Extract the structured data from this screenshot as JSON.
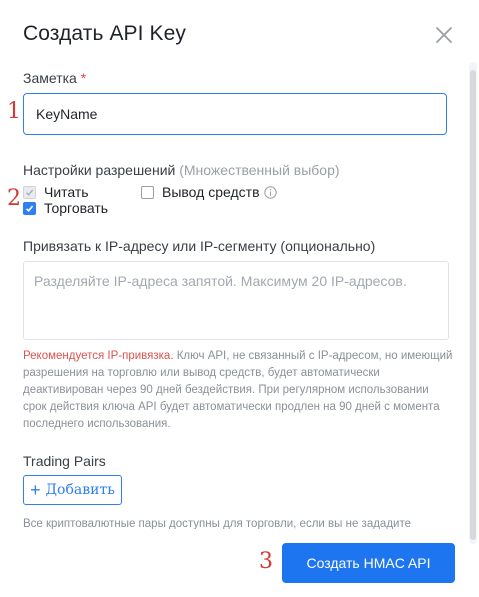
{
  "dialog": {
    "title": "Создать API Key",
    "close_icon": "close-icon"
  },
  "note": {
    "label": "Заметка",
    "required_mark": "*",
    "value": "KeyName",
    "marker": "1"
  },
  "permissions": {
    "label": "Настройки разрешений",
    "hint": "(Множественный выбор)",
    "marker": "2",
    "options": [
      {
        "label": "Читать",
        "checked": true,
        "disabled": true
      },
      {
        "label": "Торговать",
        "checked": true,
        "disabled": false
      },
      {
        "label": "Вывод средств",
        "checked": false,
        "disabled": false,
        "icon": "info-icon"
      }
    ]
  },
  "ip": {
    "label": "Привязать к IP-адресу или IP-сегменту (опционально)",
    "placeholder": "Разделяйте IP-адреса запятой. Максимум 20 IP-адресов.",
    "warning_accent": "Рекомендуется IP-привязка.",
    "warning_text": " Ключ API, не связанный с IP-адресом, но имеющий разрешения на торговлю или вывод средств, будет автоматически деактивирован через 90 дней бездействия. При регулярном использовании срок действия ключа API будет автоматически продлен на 90 дней с момента последнего использования."
  },
  "trading_pairs": {
    "label": "Trading Pairs",
    "add_label": "Добавить",
    "add_icon": "plus-icon",
    "footnote": "Все криптовалютные пары доступны для торговли, если вы не зададите"
  },
  "footer": {
    "create_label": "Создать HMAC API",
    "marker": "3"
  },
  "colors": {
    "accent": "#1e75f0",
    "warning": "#d9534f",
    "marker": "#d03a33"
  }
}
